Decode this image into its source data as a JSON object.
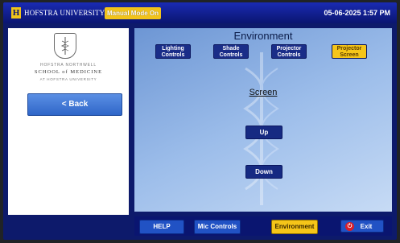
{
  "header": {
    "brand": "HOFSTRA UNIVERSITY.",
    "manual_mode_label": "Manual Mode On",
    "datetime": "05-06-2025 1:57 PM"
  },
  "sidebar": {
    "school_line1": "HOFSTRA NORTHWELL",
    "school_line2": "SCHOOL of MEDICINE",
    "school_line3": "AT HOFSTRA UNIVERSITY",
    "back_label": "< Back"
  },
  "main": {
    "title": "Environment",
    "tabs": [
      {
        "label_line1": "Lighting",
        "label_line2": "Controls",
        "active": false
      },
      {
        "label_line1": "Shade",
        "label_line2": "Controls",
        "active": false
      },
      {
        "label_line1": "Projector",
        "label_line2": "Controls",
        "active": false
      },
      {
        "label_line1": "Projector",
        "label_line2": "Screen",
        "active": true
      }
    ],
    "section_label": "Screen",
    "up_label": "Up",
    "down_label": "Down"
  },
  "bottom_bar": {
    "help_label": "HELP",
    "mic_label": "Mic Controls",
    "environment_label": "Environment",
    "exit_label": "Exit"
  },
  "colors": {
    "accent_yellow": "#f5c519",
    "navy": "#0d1a6b",
    "button_blue": "#2152c4",
    "exit_red": "#d81e2a"
  },
  "icons": {
    "brand_logo": "hofstra-h-icon",
    "exit": "power-icon",
    "seal": "caduceus-seal-icon"
  }
}
